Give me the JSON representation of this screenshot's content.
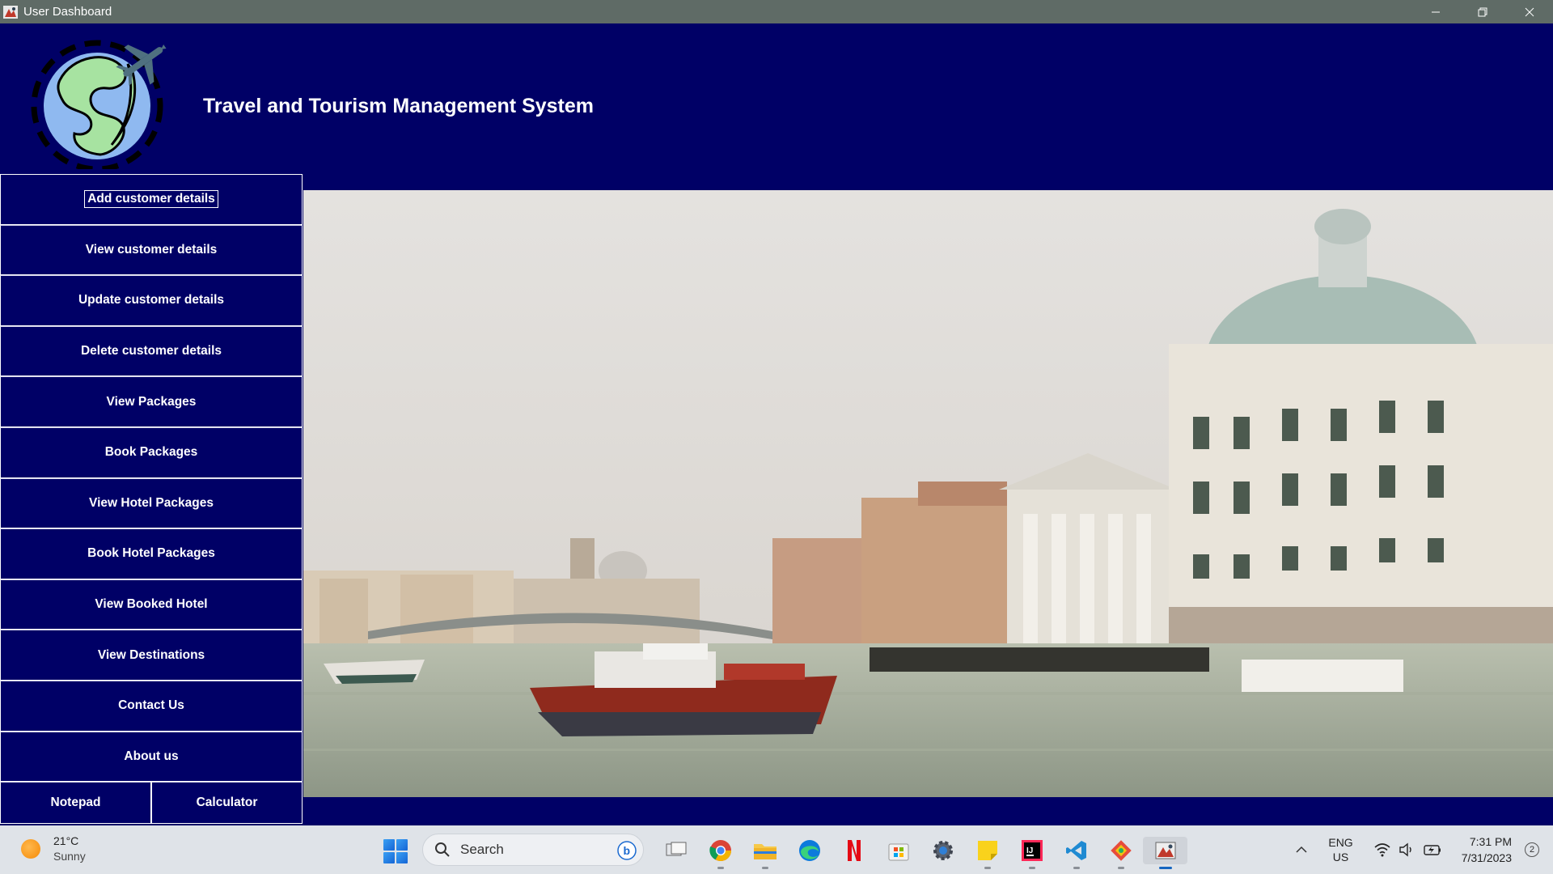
{
  "window": {
    "title": "User Dashboard"
  },
  "app": {
    "title": "Travel and Tourism Management System"
  },
  "menu": {
    "items": [
      {
        "label": "Add customer details"
      },
      {
        "label": "View customer details"
      },
      {
        "label": "Update customer details"
      },
      {
        "label": "Delete customer details"
      },
      {
        "label": "View Packages"
      },
      {
        "label": "Book Packages"
      },
      {
        "label": "View Hotel Packages"
      },
      {
        "label": "Book Hotel Packages"
      },
      {
        "label": "View Booked Hotel"
      },
      {
        "label": "View Destinations"
      },
      {
        "label": "Contact Us"
      },
      {
        "label": "About us"
      }
    ],
    "notepad_label": "Notepad",
    "calculator_label": "Calculator"
  },
  "taskbar": {
    "weather": {
      "temp": "21°C",
      "condition": "Sunny"
    },
    "search_placeholder": "Search",
    "apps": [
      "task-view",
      "chrome",
      "file-explorer",
      "edge",
      "netflix",
      "microsoft-store",
      "settings",
      "sticky-notes",
      "intellij",
      "vscode",
      "git",
      "java-app"
    ],
    "lang": "ENG",
    "region": "US",
    "time": "7:31 PM",
    "date": "7/31/2023",
    "notification_count": "2"
  },
  "colors": {
    "app_background": "#000066",
    "titlebar": "#5f6b66",
    "taskbar": "#dfe3e8"
  }
}
